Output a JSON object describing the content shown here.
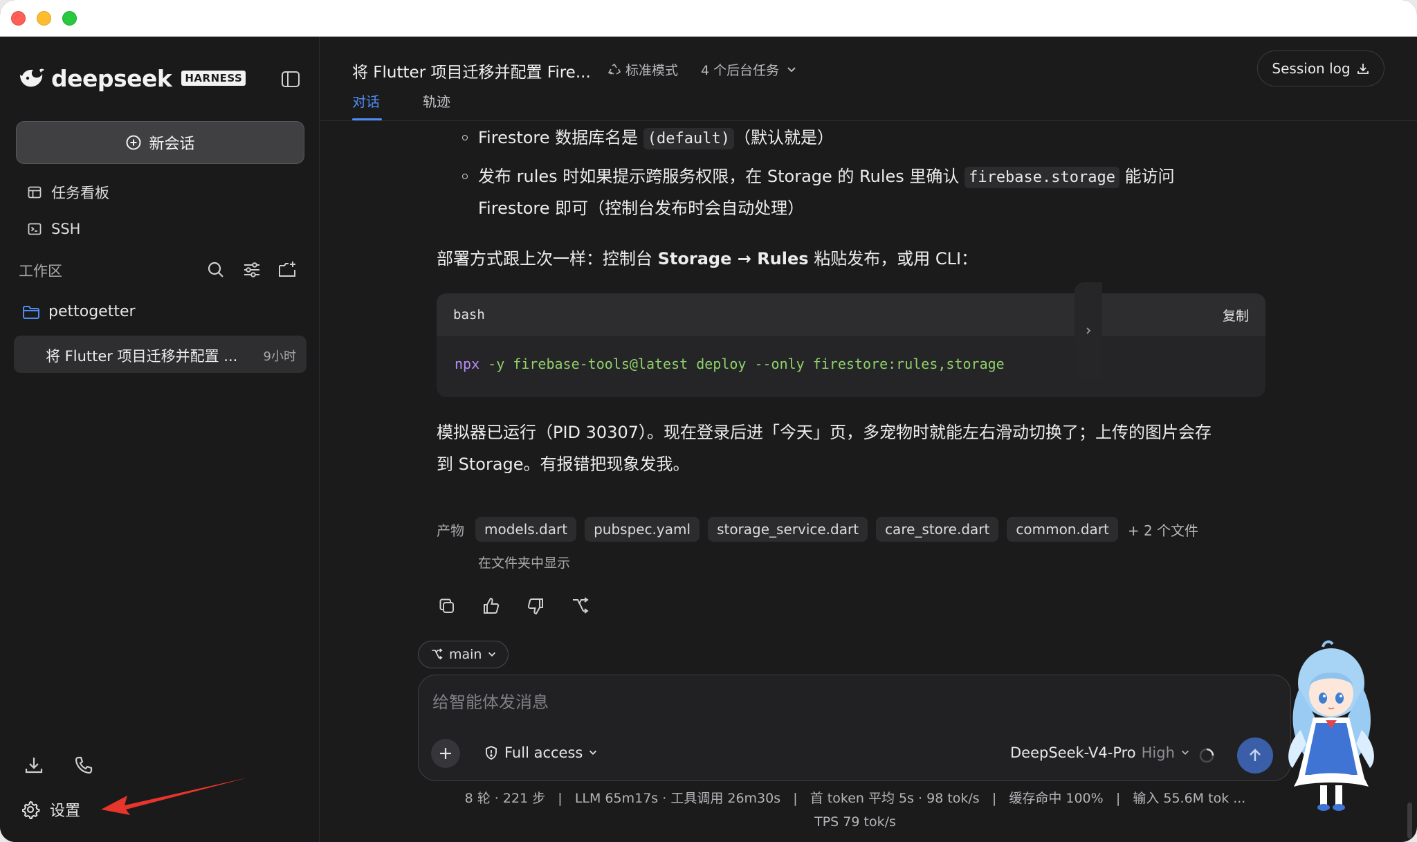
{
  "sidebar": {
    "logo_text": "deepseek",
    "logo_badge": "HARNESS",
    "new_chat": "新会话",
    "task_board": "任务看板",
    "ssh": "SSH",
    "workspace_label": "工作区",
    "folder": "pettogetter",
    "session_title": "将 Flutter 项目迁移并配置 ...",
    "session_time": "9小时",
    "settings": "设置"
  },
  "header": {
    "title": "将 Flutter 项目迁移并配置 Fire...",
    "mode": "标准模式",
    "tasks": "4 个后台任务",
    "session_log": "Session log",
    "tabs": [
      "对话",
      "轨迹"
    ]
  },
  "message": {
    "bullet1_pre": "Firestore 数据库名是 ",
    "bullet1_code": "(default)",
    "bullet1_post": "（默认就是）",
    "bullet2_pre": "发布 rules 时如果提示跨服务权限，在 Storage 的 Rules 里确认 ",
    "bullet2_code": "firebase.storage",
    "bullet2_post": " 能访问",
    "bullet2_line2": "Firestore 即可（控制台发布时会自动处理）",
    "deploy_pre": "部署方式跟上次一样：控制台 ",
    "deploy_bold": "Storage → Rules",
    "deploy_post": " 粘贴发布，或用 CLI：",
    "code_lang": "bash",
    "copy": "复制",
    "code_cmd": "npx",
    "code_rest": " -y firebase-tools@latest deploy --only firestore:rules,storage",
    "summary_line1": "模拟器已运行（PID 30307）。现在登录后进「今天」页，多宠物时就能左右滑动切换了；上传的图片会存",
    "summary_line2": "到 Storage。有报错把现象发我。"
  },
  "artifacts": {
    "label": "产物",
    "files": [
      "models.dart",
      "pubspec.yaml",
      "storage_service.dart",
      "care_store.dart",
      "common.dart"
    ],
    "more": "+ 2 个文件",
    "show_in_folder": "在文件夹中显示"
  },
  "composer": {
    "branch": "main",
    "placeholder": "给智能体发消息",
    "access": "Full access",
    "model": "DeepSeek-V4-Pro",
    "level": "High"
  },
  "stats": {
    "line1": "8 轮 · 221 步   |   LLM 65m17s · 工具调用 26m30s   |   首 token 平均 5s · 98 tok/s   |   缓存命中 100%   |   输入 55.6M tok ...",
    "line2": "TPS 79 tok/s"
  },
  "colors": {
    "accent": "#4e8cf5",
    "background": "#1b1b1c",
    "arrow": "#e8352b"
  }
}
